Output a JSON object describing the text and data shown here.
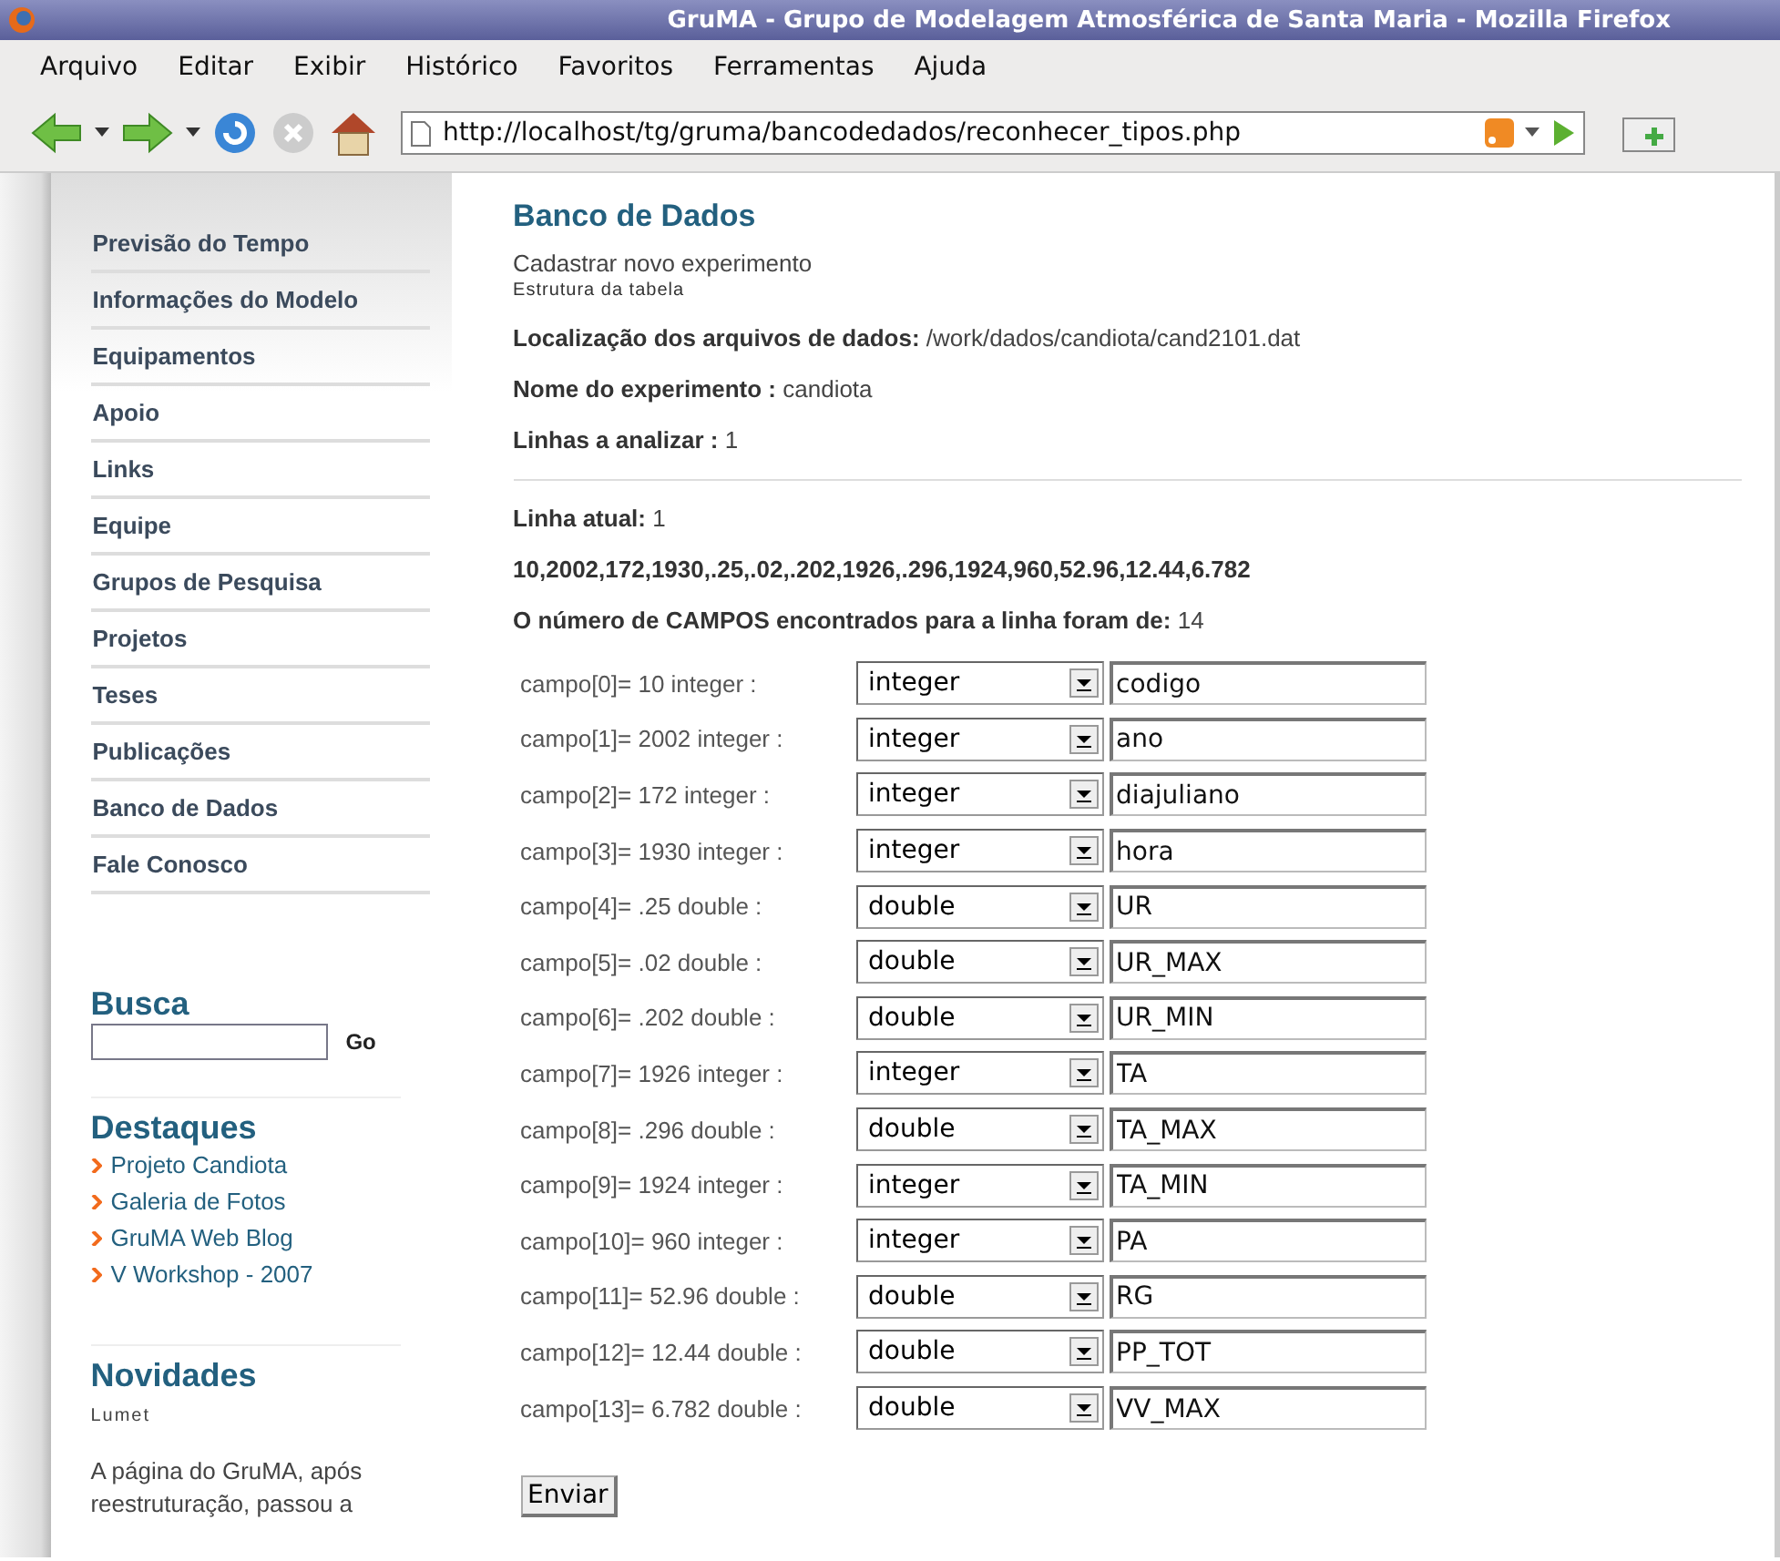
{
  "window": {
    "title": "GruMA - Grupo de Modelagem Atmosférica de Santa Maria - Mozilla Firefox"
  },
  "menu": [
    "Arquivo",
    "Editar",
    "Exibir",
    "Histórico",
    "Favoritos",
    "Ferramentas",
    "Ajuda"
  ],
  "address": {
    "value": "http://localhost/tg/gruma/bancodedados/reconhecer_tipos.php"
  },
  "sidebar": {
    "items": [
      "Previsão do Tempo",
      "Informações do Modelo",
      "Equipamentos",
      "Apoio",
      "Links",
      "Equipe",
      "Grupos de Pesquisa",
      "Projetos",
      "Teses",
      "Publicações",
      "Banco de Dados",
      "Fale Conosco"
    ],
    "search": {
      "title": "Busca",
      "button": "Go"
    },
    "highlights": {
      "title": "Destaques",
      "links": [
        "Projeto Candiota",
        "Galeria de Fotos",
        "GruMA Web Blog",
        "V Workshop - 2007"
      ]
    },
    "news": {
      "title": "Novidades",
      "author": "Lumet",
      "text": "A página do GruMA, após reestruturação, passou a"
    }
  },
  "main": {
    "title": "Banco de Dados",
    "subtitle": "Cadastrar novo experimento",
    "caption": "Estrutura da tabela",
    "info": [
      "**Localização dos arquivos de dados:** /work/dados/candiota/cand2101.dat",
      "**Nome do experimento :** candiota",
      "**Linhas a analizar :** 1"
    ],
    "info2": [
      "**Linha atual:** 1",
      "10,2002,172,1930,.25,.02,.202,1926,.296,1924,960,52.96,12.44,6.782",
      "**O número de CAMPOS encontrados para a linha foram de:** 14"
    ],
    "fields": [
      {
        "label": "campo[0]= 10 integer :",
        "type": "integer",
        "name": "codigo"
      },
      {
        "label": "campo[1]= 2002 integer :",
        "type": "integer",
        "name": "ano"
      },
      {
        "label": "campo[2]= 172 integer :",
        "type": "integer",
        "name": "diajuliano"
      },
      {
        "label": "campo[3]= 1930 integer :",
        "type": "integer",
        "name": "hora"
      },
      {
        "label": "campo[4]= .25 double :",
        "type": "double",
        "name": "UR"
      },
      {
        "label": "campo[5]= .02 double :",
        "type": "double",
        "name": "UR_MAX"
      },
      {
        "label": "campo[6]= .202 double :",
        "type": "double",
        "name": "UR_MIN"
      },
      {
        "label": "campo[7]= 1926 integer :",
        "type": "integer",
        "name": "TA"
      },
      {
        "label": "campo[8]= .296 double :",
        "type": "double",
        "name": "TA_MAX"
      },
      {
        "label": "campo[9]= 1924 integer :",
        "type": "integer",
        "name": "TA_MIN"
      },
      {
        "label": "campo[10]= 960 integer :",
        "type": "integer",
        "name": "PA"
      },
      {
        "label": "campo[11]= 52.96 double :",
        "type": "double",
        "name": "RG"
      },
      {
        "label": "campo[12]= 12.44 double :",
        "type": "double",
        "name": "PP_TOT"
      },
      {
        "label": "campo[13]= 6.782 double :",
        "type": "double",
        "name": "VV_MAX"
      }
    ],
    "submit": "Enviar"
  }
}
